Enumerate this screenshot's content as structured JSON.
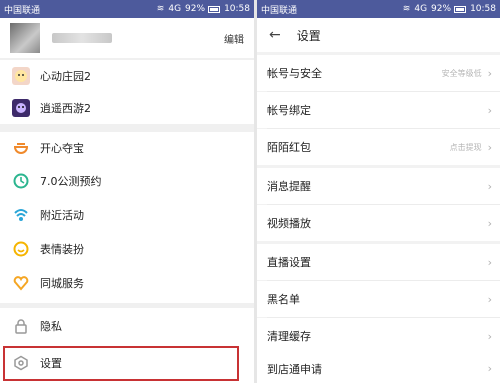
{
  "left": {
    "status": {
      "carrier": "中国联通",
      "signal": "4G",
      "battery": "92%",
      "time": "10:58"
    },
    "profile": {
      "edit_label": "编辑"
    },
    "menu": [
      {
        "label": "心动庄园2",
        "icon": "game-avatar-icon"
      },
      {
        "label": "逍遥西游2",
        "icon": "game-avatar-icon"
      },
      {
        "label": "开心夺宝",
        "icon": "bowl-icon",
        "color": "#f08a2c"
      },
      {
        "label": "7.0公测预约",
        "icon": "clock-icon",
        "color": "#2bb58f"
      },
      {
        "label": "附近活动",
        "icon": "nearby-icon",
        "color": "#2aa6d8"
      },
      {
        "label": "表情装扮",
        "icon": "smile-icon",
        "color": "#f5b400"
      },
      {
        "label": "同城服务",
        "icon": "heart-icon",
        "color": "#f5a623"
      },
      {
        "label": "隐私",
        "icon": "lock-icon"
      },
      {
        "label": "设置",
        "icon": "settings-hex-icon"
      }
    ]
  },
  "right": {
    "status": {
      "carrier": "中国联通",
      "signal": "4G",
      "battery": "92%",
      "time": "10:58"
    },
    "header": {
      "title": "设置"
    },
    "groups": [
      [
        {
          "label": "帐号与安全",
          "hint": "安全等级低"
        },
        {
          "label": "帐号绑定",
          "hint": ""
        },
        {
          "label": "陌陌红包",
          "hint": "点击提现"
        }
      ],
      [
        {
          "label": "消息提醒",
          "hint": ""
        },
        {
          "label": "视频播放",
          "hint": ""
        }
      ],
      [
        {
          "label": "直播设置",
          "hint": ""
        },
        {
          "label": "黑名单",
          "hint": ""
        },
        {
          "label": "清理缓存",
          "hint": ""
        }
      ],
      [
        {
          "label": "到店通申请",
          "hint": ""
        }
      ]
    ]
  }
}
